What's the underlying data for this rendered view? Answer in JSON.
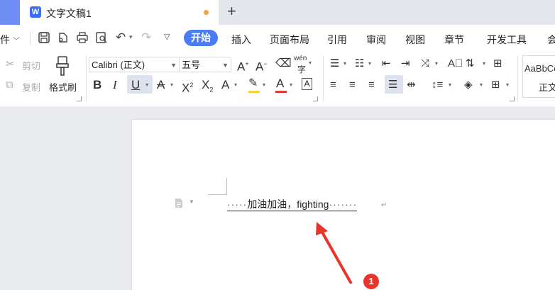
{
  "tab": {
    "icon_letter": "W",
    "title": "文字文稿1"
  },
  "menubar": {
    "file_label": "件",
    "items": [
      "开始",
      "插入",
      "页面布局",
      "引用",
      "审阅",
      "视图",
      "章节",
      "开发工具",
      "会"
    ]
  },
  "ribbon": {
    "cut": "剪切",
    "copy": "复制",
    "format_painter": "格式刷",
    "font_name": "Calibri (正文)",
    "font_size": "五号",
    "phonetic_glyph": "wén",
    "style_sample": "AaBbCc",
    "style_name": "正文"
  },
  "document": {
    "leading_dots": "·····",
    "text": "加油加油，fighting",
    "trailing_dots": "·······",
    "paragraph_mark": "↵"
  },
  "annotation": {
    "step_number": "1",
    "color": "#e8352b"
  },
  "colors": {
    "accent": "#4b7bf5",
    "font_color_bar": "#e53935",
    "highlight_bar": "#f5d23a"
  }
}
